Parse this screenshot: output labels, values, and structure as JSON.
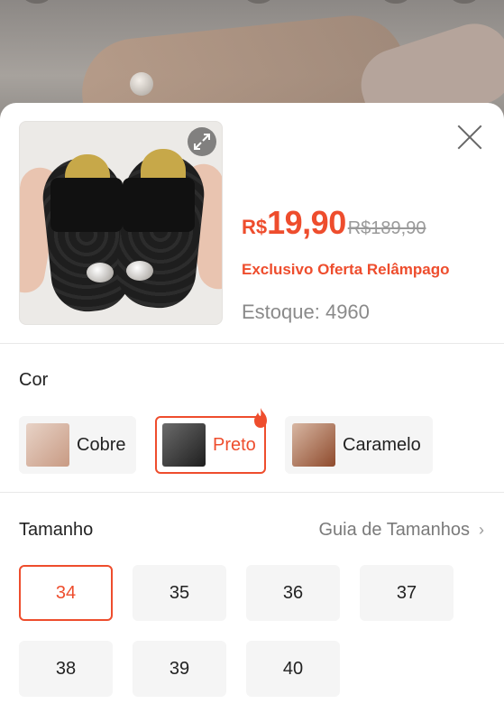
{
  "product": {
    "currency": "R$",
    "price": "19,90",
    "old_price": "R$189,90",
    "flash_label": "Exclusivo Oferta Relâmpago",
    "stock": "Estoque: 4960"
  },
  "color_section": {
    "title": "Cor",
    "options": [
      {
        "label": "Cobre",
        "selected": false,
        "swatch": "#d8b4a2"
      },
      {
        "label": "Preto",
        "selected": true,
        "swatch": "#2b2b2b"
      },
      {
        "label": "Caramelo",
        "selected": false,
        "swatch": "#a8643f"
      }
    ]
  },
  "size_section": {
    "title": "Tamanho",
    "guide_label": "Guia de Tamanhos",
    "sizes": [
      {
        "label": "34",
        "selected": true
      },
      {
        "label": "35",
        "selected": false
      },
      {
        "label": "36",
        "selected": false
      },
      {
        "label": "37",
        "selected": false
      },
      {
        "label": "38",
        "selected": false
      },
      {
        "label": "39",
        "selected": false
      },
      {
        "label": "40",
        "selected": false
      }
    ]
  },
  "colors": {
    "accent": "#ee4d2d",
    "muted": "#8a8a8a",
    "chip_bg": "#f5f5f5"
  },
  "icons": [
    "close-icon",
    "expand-icon",
    "fire-icon",
    "chevron-right-icon"
  ]
}
